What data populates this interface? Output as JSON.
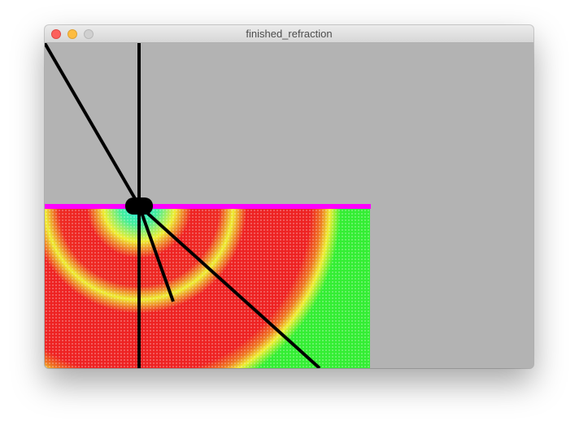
{
  "window": {
    "title": "finished_refraction",
    "controls": {
      "close": "close-button",
      "minimize": "minimize-button",
      "zoom": "zoom-button"
    }
  },
  "scene": {
    "colors": {
      "background": "#b3b3b3",
      "interface_line": "#ff00ff",
      "medium_base": "#33ee33",
      "wave_peak": "#ee2222",
      "wave_mid": "#eeee33",
      "wave_center": "#22eeee",
      "rays": "#000000",
      "source_marker": "#000000"
    }
  }
}
